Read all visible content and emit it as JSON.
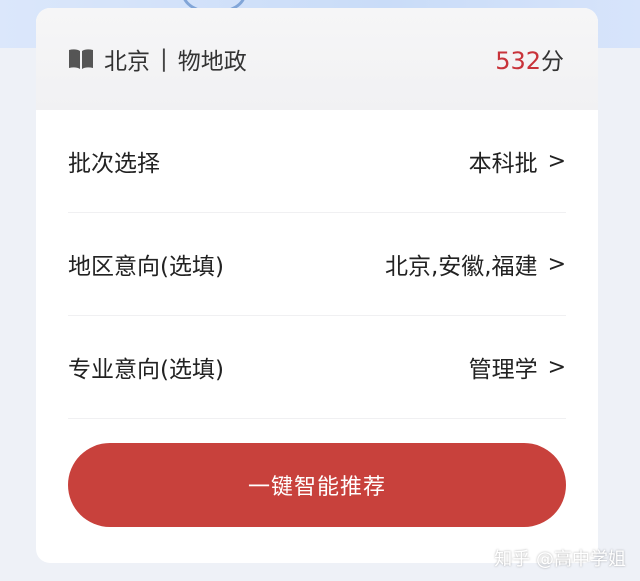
{
  "header": {
    "icon": "book-icon",
    "region": "北京",
    "separator": "|",
    "subjects": "物地政",
    "score_value": "532",
    "score_unit": "分",
    "accent_color": "#c8333a"
  },
  "rows": [
    {
      "label": "批次选择",
      "value": "本科批",
      "chevron": ">"
    },
    {
      "label": "地区意向(选填)",
      "value": "北京,安徽,福建",
      "chevron": ">"
    },
    {
      "label": "专业意向(选填)",
      "value": "管理学",
      "chevron": ">"
    }
  ],
  "cta": {
    "label": "一键智能推荐",
    "color": "#c8413c"
  },
  "watermark": "知乎 @高中学姐"
}
